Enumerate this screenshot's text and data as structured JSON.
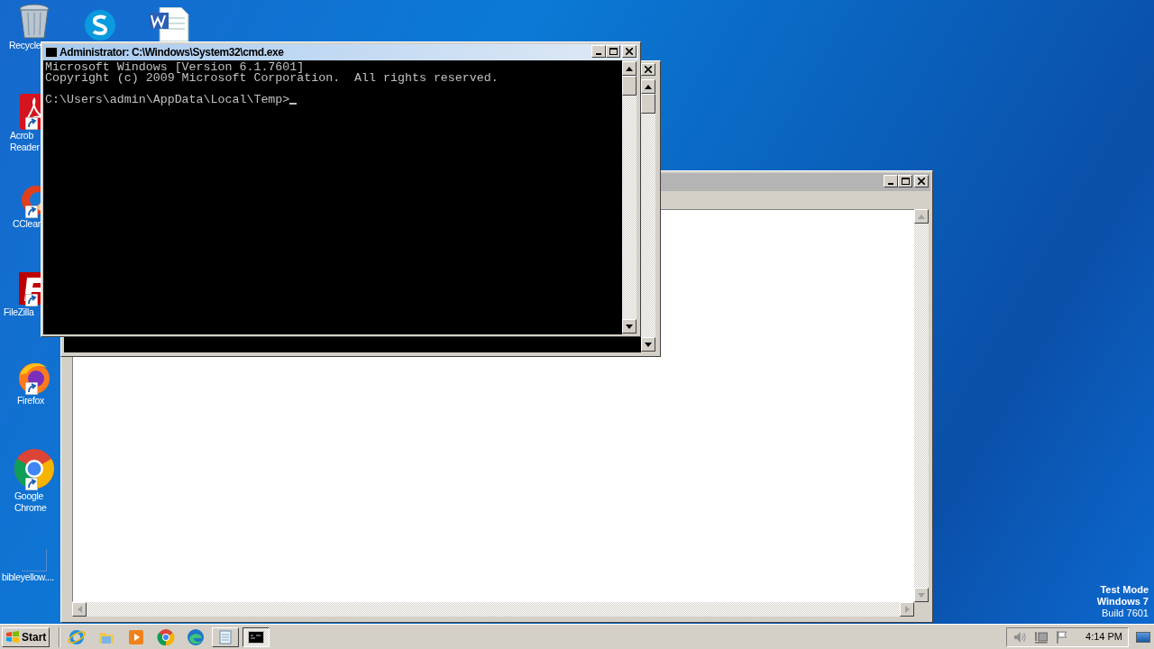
{
  "desktop_icons": [
    {
      "lines": [
        "Recycle"
      ]
    },
    {
      "lines": [
        "Acrob",
        "Reader"
      ]
    },
    {
      "lines": [
        "CClear"
      ]
    },
    {
      "lines": [
        "FileZilla"
      ]
    },
    {
      "lines": [
        "Firefox"
      ]
    },
    {
      "lines": [
        "Google",
        "Chrome"
      ]
    },
    {
      "lines": [
        "bibleyellow...."
      ]
    }
  ],
  "cmd_window": {
    "title": "Administrator: C:\\Windows\\System32\\cmd.exe",
    "banner": [
      "Microsoft Windows [Version 6.1.7601]",
      "Copyright (c) 2009 Microsoft Corporation.  All rights reserved."
    ],
    "prompt": "C:\\Users\\admin\\AppData\\Local\\Temp>"
  },
  "test_mode": [
    {
      "text": "Test Mode",
      "bold": true
    },
    {
      "text": "Windows 7",
      "bold": true
    },
    {
      "text": "Build 7601",
      "bold": false
    }
  ],
  "taskbar": {
    "start": "Start",
    "tasks": [
      {
        "kind": "notepad",
        "selected": false
      },
      {
        "kind": "console",
        "selected": true
      }
    ],
    "clock": "4:14 PM"
  }
}
